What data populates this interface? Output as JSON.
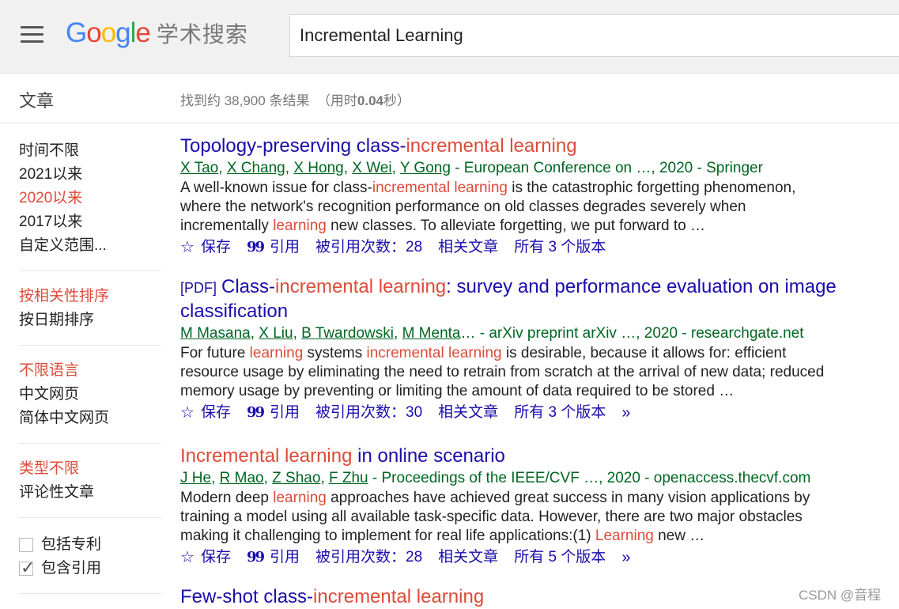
{
  "header": {
    "logo_google": [
      "G",
      "o",
      "o",
      "g",
      "l",
      "e"
    ],
    "logo_sub": "学术搜索",
    "search_value": "Incremental Learning"
  },
  "section": {
    "title": "文章",
    "stats_pre": "找到约 38,900 条结果",
    "stats_mid": "（用时",
    "stats_time": "0.04",
    "stats_post": "秒）"
  },
  "sidebar": {
    "time": [
      "时间不限",
      "2021以来",
      "2020以来",
      "2017以来",
      "自定义范围..."
    ],
    "time_selected": 2,
    "sort": [
      "按相关性排序",
      "按日期排序"
    ],
    "sort_selected": 0,
    "lang": [
      "不限语言",
      "中文网页",
      "简体中文网页"
    ],
    "lang_selected": 0,
    "type": [
      "类型不限",
      "评论性文章"
    ],
    "type_selected": 0,
    "checkbox_patents": "包括专利",
    "checkbox_citations": "包含引用",
    "patents_checked": false,
    "citations_checked": true
  },
  "actions": {
    "save": "保存",
    "cite": "引用",
    "related": "相关文章"
  },
  "results": [
    {
      "title_parts": [
        [
          "Topology-preserving class-",
          false
        ],
        [
          "incremental learning",
          true
        ]
      ],
      "pdf": "",
      "authors": [
        "X Tao",
        "X Chang",
        "X Hong",
        "X Wei",
        "Y Gong"
      ],
      "authors_more": "",
      "source": " - European Conference on …, 2020 - Springer",
      "snippet": [
        [
          "A well-known issue for class-",
          false
        ],
        [
          "incremental learning",
          true
        ],
        [
          " is the catastrophic forgetting phenomenon, where the network's recognition performance on old classes degrades severely when incrementally ",
          false
        ],
        [
          "learning",
          true
        ],
        [
          " new classes. To alleviate forgetting, we put forward to …",
          false
        ]
      ],
      "cited": "被引用次数：28",
      "versions": "所有 3 个版本",
      "more": false
    },
    {
      "title_parts": [
        [
          "Class-",
          false
        ],
        [
          "incremental learning",
          true
        ],
        [
          ": survey and performance evaluation on image classification",
          false
        ]
      ],
      "pdf": "[PDF]",
      "authors": [
        "M Masana",
        "X Liu",
        "B Twardowski",
        "M Menta"
      ],
      "authors_more": "…",
      "source": " - arXiv preprint arXiv …, 2020 - researchgate.net",
      "snippet": [
        [
          "For future ",
          false
        ],
        [
          "learning",
          true
        ],
        [
          " systems ",
          false
        ],
        [
          "incremental learning",
          true
        ],
        [
          " is desirable, because it allows for: efficient resource usage by eliminating the need to retrain from scratch at the arrival of new data; reduced memory usage by preventing or limiting the amount of data required to be stored …",
          false
        ]
      ],
      "cited": "被引用次数：30",
      "versions": "所有 3 个版本",
      "more": true
    },
    {
      "title_parts": [
        [
          "Incremental learning",
          true
        ],
        [
          " in online scenario",
          false
        ]
      ],
      "pdf": "",
      "authors": [
        "J He",
        "R Mao",
        "Z Shao",
        "F Zhu"
      ],
      "authors_more": "",
      "source": " - Proceedings of the IEEE/CVF …, 2020 - openaccess.thecvf.com",
      "snippet": [
        [
          "Modern deep ",
          false
        ],
        [
          "learning",
          true
        ],
        [
          " approaches have achieved great success in many vision applications by training a model using all available task-specific data. However, there are two major obstacles making it challenging to implement for real life applications:(1) ",
          false
        ],
        [
          "Learning",
          true
        ],
        [
          " new …",
          false
        ]
      ],
      "cited": "被引用次数：28",
      "versions": "所有 5 个版本",
      "more": true
    },
    {
      "title_parts": [
        [
          "Few-shot class-",
          false
        ],
        [
          "incremental learning",
          true
        ]
      ],
      "pdf": "",
      "authors": [],
      "authors_more": "",
      "source": "",
      "snippet": [],
      "cited": "",
      "versions": "",
      "more": false
    }
  ],
  "watermark": "CSDN @音程",
  "colors": {
    "link": "#1a0dab",
    "highlight": "#dd4b39",
    "green": "#006621"
  }
}
